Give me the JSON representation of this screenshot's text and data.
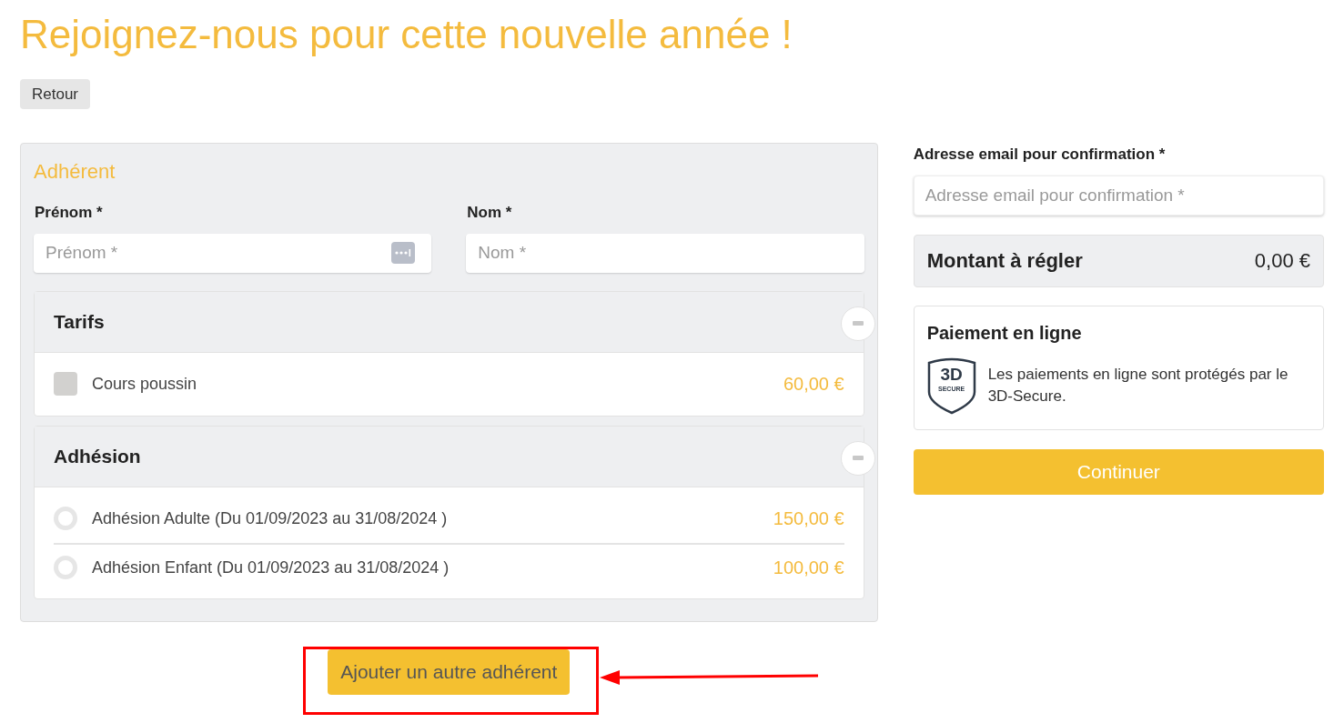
{
  "page_title": "Rejoignez-nous pour cette nouvelle année !",
  "back_button": "Retour",
  "member_form": {
    "title": "Adhérent",
    "fields": [
      {
        "label": "Prénom *",
        "placeholder": "Prénom *"
      },
      {
        "label": "Nom *",
        "placeholder": "Nom *"
      }
    ],
    "sections": [
      {
        "title": "Tarifs",
        "kind": "checkbox",
        "options": [
          {
            "label": "Cours poussin",
            "price": "60,00 €",
            "checked": false
          }
        ]
      },
      {
        "title": "Adhésion",
        "kind": "radio",
        "options": [
          {
            "label": "Adhésion Adulte (Du 01/09/2023 au 31/08/2024 )",
            "price": "150,00 €",
            "selected": false
          },
          {
            "label": "Adhésion Enfant (Du 01/09/2023 au 31/08/2024 )",
            "price": "100,00 €",
            "selected": false
          }
        ]
      }
    ]
  },
  "add_member_button": "Ajouter un autre adhérent",
  "summary": {
    "email": {
      "label": "Adresse email pour confirmation *",
      "placeholder": "Adresse email pour confirmation *"
    },
    "total": {
      "label": "Montant à régler",
      "amount": "0,00 €"
    },
    "payment": {
      "title": "Paiement en ligne",
      "badge_main": "3D",
      "badge_sub": "SECURE",
      "text": "Les paiements en ligne sont protégés par le 3D-Secure."
    },
    "continue_button": "Continuer"
  }
}
